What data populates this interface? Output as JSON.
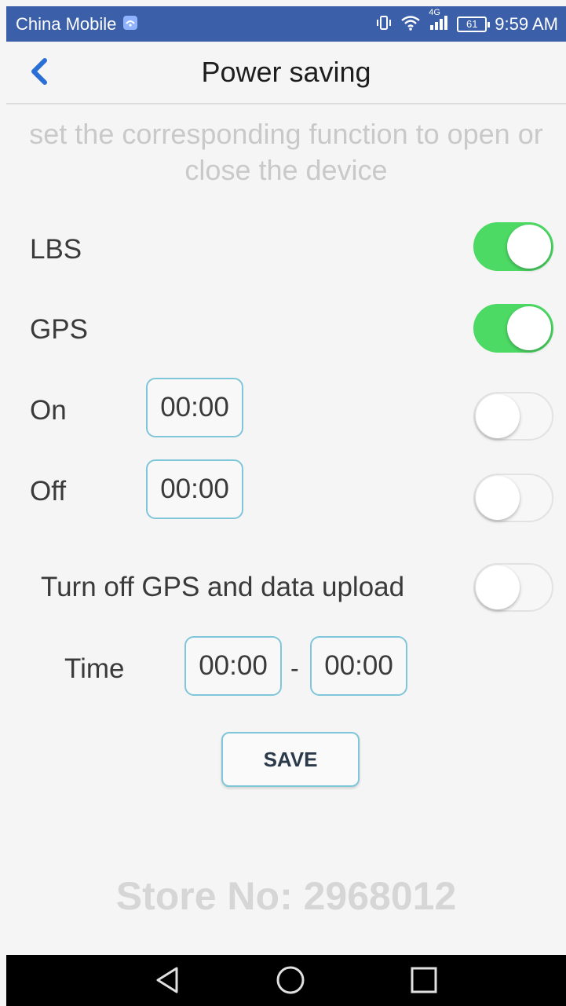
{
  "status_bar": {
    "carrier": "China Mobile",
    "network": "4G",
    "battery": "61",
    "time": "9:59 AM"
  },
  "header": {
    "title": "Power saving"
  },
  "instruction": "set the corresponding function to open or close the device",
  "settings": {
    "lbs": {
      "label": "LBS",
      "enabled": true
    },
    "gps": {
      "label": "GPS",
      "enabled": true
    },
    "on": {
      "label": "On",
      "time": "00:00",
      "enabled": false
    },
    "off": {
      "label": "Off",
      "time": "00:00",
      "enabled": false
    },
    "gps_upload": {
      "label": "Turn off GPS and data upload",
      "enabled": false
    },
    "time_range": {
      "label": "Time",
      "start": "00:00",
      "separator": "-",
      "end": "00:00"
    }
  },
  "save_label": "SAVE",
  "watermark": "Store No: 2968012",
  "colors": {
    "status_bar": "#3b5fa8",
    "toggle_on": "#4cd964",
    "back_arrow": "#2a6fd6",
    "input_border": "#7fc6da"
  },
  "icons": {
    "back": "chevron-left-icon",
    "nav": [
      "back-triangle-icon",
      "home-circle-icon",
      "recents-square-icon"
    ]
  }
}
